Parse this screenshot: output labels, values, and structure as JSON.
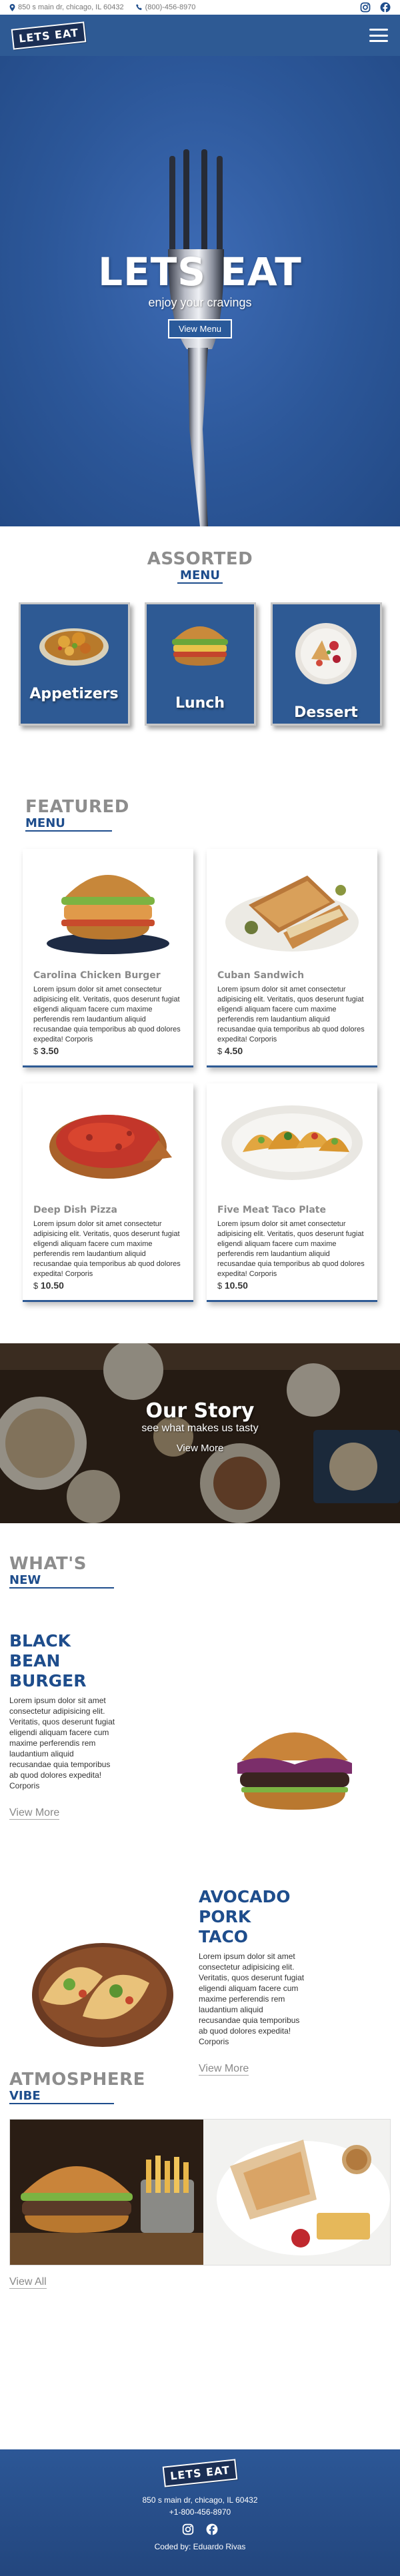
{
  "topbar": {
    "address": "850 s main dr, chicago, IL 60432",
    "phone": "(800)-456-8970",
    "social": [
      "instagram-icon",
      "facebook-icon"
    ]
  },
  "header": {
    "logo": "LETS EAT",
    "menu_icon": "hamburger-icon"
  },
  "hero": {
    "title": "LETS EAT",
    "subtitle": "enjoy your cravings",
    "button": "View Menu"
  },
  "assorted": {
    "heading": "ASSORTED",
    "subheading": "MENU",
    "categories": [
      {
        "label": "Appetizers",
        "icon": "appetizers-plate"
      },
      {
        "label": "Lunch",
        "icon": "sandwich"
      },
      {
        "label": "Dessert",
        "icon": "dessert-plate"
      }
    ]
  },
  "featured": {
    "heading": "FEATURED",
    "subheading": "MENU",
    "items": [
      {
        "name": "Carolina Chicken Burger",
        "desc": "Lorem ipsum dolor sit amet consectetur adipisicing elit. Veritatis, quos deserunt fugiat eligendi aliquam facere cum maxime perferendis rem laudantium aliquid recusandae quia temporibus ab quod dolores expedita! Corporis",
        "currency": "$",
        "price": "3.50"
      },
      {
        "name": "Cuban Sandwich",
        "desc": "Lorem ipsum dolor sit amet consectetur adipisicing elit. Veritatis, quos deserunt fugiat eligendi aliquam facere cum maxime perferendis rem laudantium aliquid recusandae quia temporibus ab quod dolores expedita! Corporis",
        "currency": "$",
        "price": "4.50"
      },
      {
        "name": "Deep Dish Pizza",
        "desc": "Lorem ipsum dolor sit amet consectetur adipisicing elit. Veritatis, quos deserunt fugiat eligendi aliquam facere cum maxime perferendis rem laudantium aliquid recusandae quia temporibus ab quod dolores expedita! Corporis",
        "currency": "$",
        "price": "10.50"
      },
      {
        "name": "Five Meat Taco Plate",
        "desc": "Lorem ipsum dolor sit amet consectetur adipisicing elit. Veritatis, quos deserunt fugiat eligendi aliquam facere cum maxime perferendis rem laudantium aliquid recusandae quia temporibus ab quod dolores expedita! Corporis",
        "currency": "$",
        "price": "10.50"
      }
    ]
  },
  "story": {
    "title": "Our Story",
    "subtitle": "see what makes us tasty",
    "link": "View More"
  },
  "whats_new": {
    "heading": "WHAT'S",
    "subheading": "NEW",
    "items": [
      {
        "title": "BLACK BEAN BURGER",
        "desc": "Lorem ipsum dolor sit amet consectetur adipisicing elit. Veritatis, quos deserunt fugiat eligendi aliquam facere cum maxime perferendis rem laudantium aliquid recusandae quia temporibus ab quod dolores expedita! Corporis",
        "link": "View More"
      },
      {
        "title": "AVOCADO PORK TACO",
        "desc": "Lorem ipsum dolor sit amet consectetur adipisicing elit. Veritatis, quos deserunt fugiat eligendi aliquam facere cum maxime perferendis rem laudantium aliquid recusandae quia temporibus ab quod dolores expedita! Corporis",
        "link": "View More"
      }
    ]
  },
  "atmosphere": {
    "heading": "ATMOSPHERE",
    "subheading": "VIBE",
    "link": "View All"
  },
  "footer": {
    "logo": "LETS EAT",
    "address": "850 s main dr, chicago, IL 60432",
    "phone": "+1-800-456-8970",
    "social": [
      "instagram-icon",
      "facebook-icon"
    ],
    "credit": "Coded by: Eduardo Rivas"
  },
  "colors": {
    "brand_blue": "#2e5a94",
    "heading_blue": "#1e4d8c",
    "heading_gray": "#8d8d8d"
  }
}
